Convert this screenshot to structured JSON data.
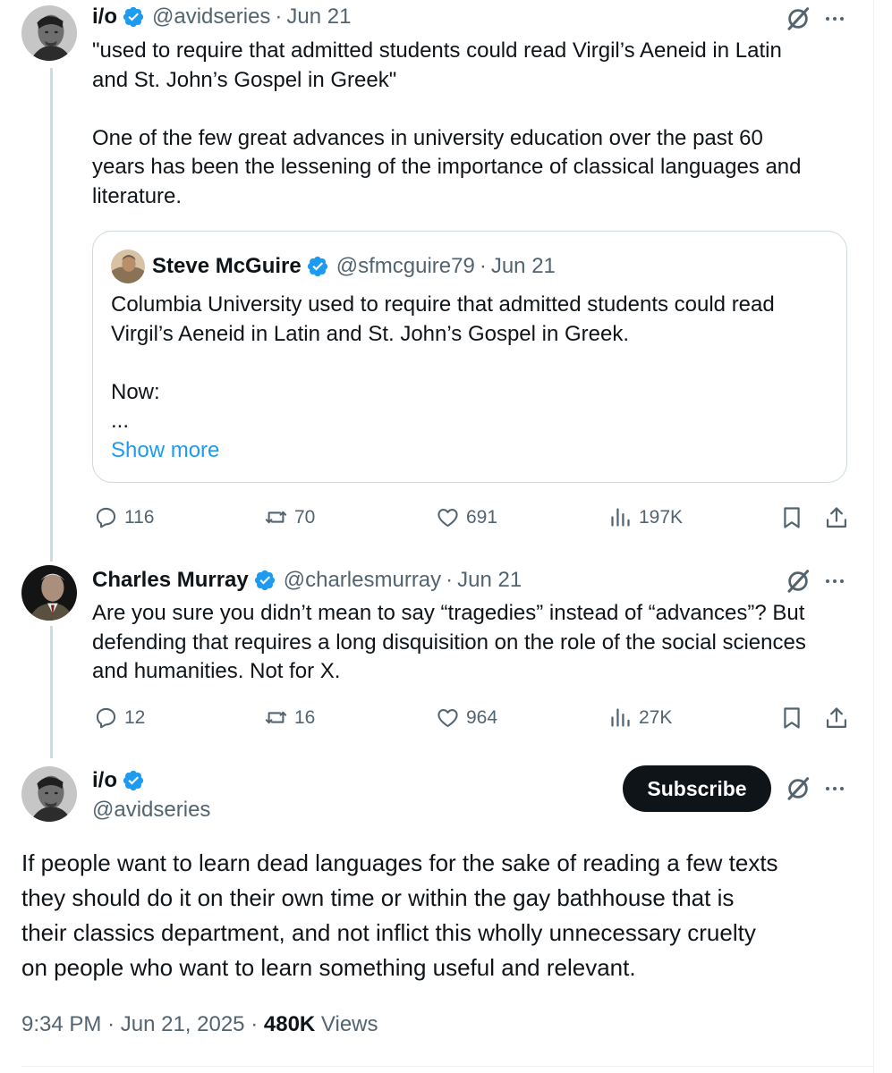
{
  "tweet1": {
    "name": "i/o",
    "handle": "@avidseries",
    "separator": "·",
    "date": "Jun 21",
    "text": "\"used to require that admitted students could read Virgil’s Aeneid in Latin\nand St. John’s Gospel in Greek\"\n\nOne of the few great advances in university education over the past 60\nyears has been the lessening of the importance of classical languages and\nliterature.",
    "quote": {
      "name": "Steve McGuire",
      "handle": "@sfmcguire79",
      "separator": "·",
      "date": "Jun 21",
      "text": "Columbia University used to require that admitted students could read\nVirgil’s Aeneid in Latin and St. John’s Gospel in Greek.\n\nNow:\n...",
      "show_more": "Show more"
    },
    "actions": {
      "replies": "116",
      "reposts": "70",
      "likes": "691",
      "views": "197K"
    }
  },
  "tweet2": {
    "name": "Charles Murray",
    "handle": "@charlesmurray",
    "separator": "·",
    "date": "Jun 21",
    "text": "Are you sure you didn’t mean to say “tragedies” instead of “advances”? But\ndefending that requires a long disquisition on the role of the social sciences\nand humanities. Not for X.",
    "actions": {
      "replies": "12",
      "reposts": "16",
      "likes": "964",
      "views": "27K"
    }
  },
  "tweet3": {
    "name": "i/o",
    "handle": "@avidseries",
    "subscribe_label": "Subscribe",
    "text": "If people want to learn dead languages for the sake of reading a few texts\nthey should do it on their own time or within the gay bathhouse that is\ntheir classics department, and not inflict this wholly unnecessary cruelty\non people who want to learn something useful and relevant.",
    "time": "9:34 PM",
    "separator": "·",
    "full_date": "Jun 21, 2025",
    "views_count": "480K",
    "views_label": "Views"
  },
  "icons": {
    "verified": "verified-badge-icon",
    "grok": "grok-icon",
    "more": "more-icon",
    "reply": "reply-icon",
    "repost": "repost-icon",
    "like": "like-icon",
    "views": "views-icon",
    "bookmark": "bookmark-icon",
    "share": "share-icon"
  },
  "colors": {
    "text": "#0f1419",
    "muted": "#536471",
    "accent": "#1d9bf0",
    "border": "#cfd9de"
  }
}
